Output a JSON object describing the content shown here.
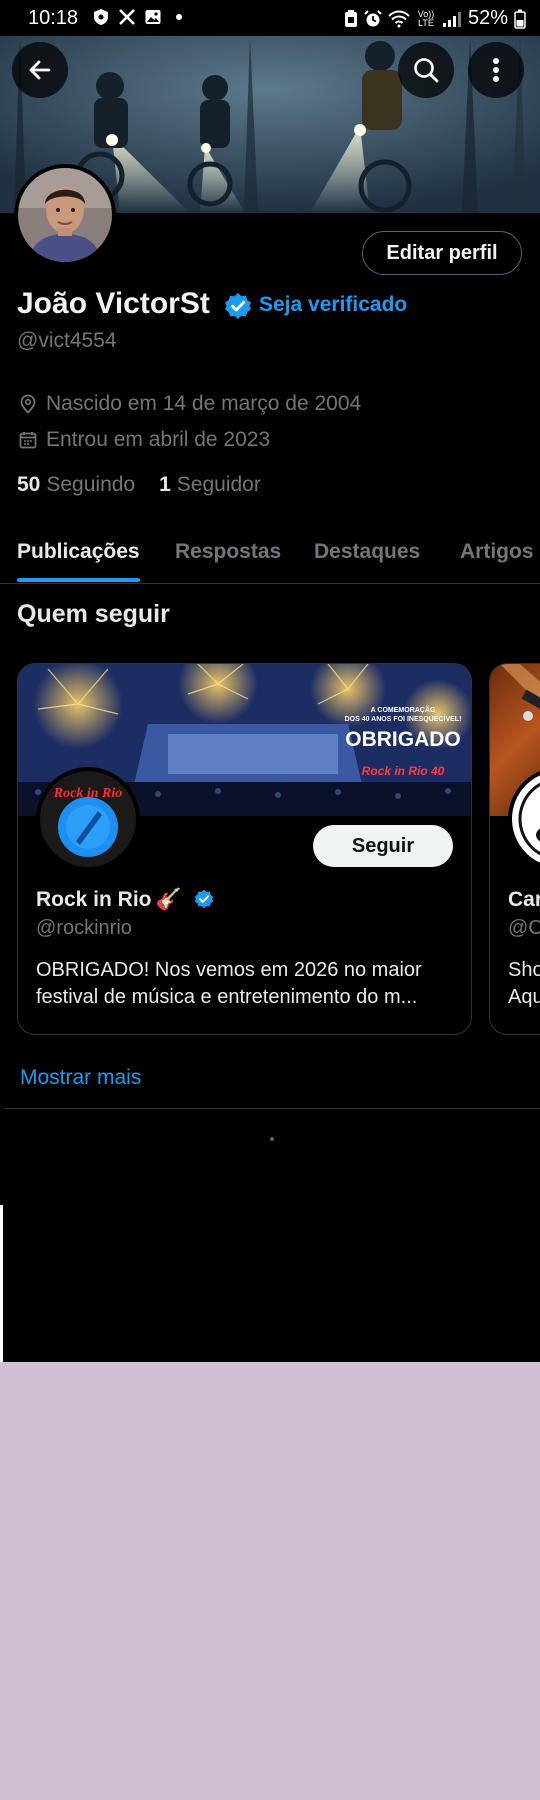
{
  "status_bar": {
    "time": "10:18",
    "battery": "52%",
    "network": "Vo)) LTE"
  },
  "profile": {
    "name": "João VictorSt",
    "verify_cta": "Seja verificado",
    "handle": "@vict4554",
    "edit_button": "Editar perfil",
    "birthday": "Nascido em 14 de março de 2004",
    "joined": "Entrou em abril de 2023",
    "following_count": "50",
    "following_label": "Seguindo",
    "followers_count": "1",
    "followers_label": "Seguidor"
  },
  "tabs": [
    "Publicações",
    "Respostas",
    "Destaques",
    "Artigos"
  ],
  "who_to_follow": {
    "title": "Quem seguir",
    "cards": [
      {
        "name": "Rock in Rio",
        "emoji": "🎸",
        "handle": "@rockinrio",
        "bio_line1": "OBRIGADO! Nos vemos em 2026 no maior",
        "bio_line2": "festival de música e entretenimento do m...",
        "follow_label": "Seguir",
        "banner_text": {
          "small_line1": "A COMEMORAÇÃO",
          "small_line2": "DOS 40 ANOS FOI INESQUECÍVEL!",
          "headline": "OBRIGADO",
          "logo": "Rock in Rio 40"
        },
        "avatar_logo": "Rock in Rio"
      },
      {
        "name": "Car",
        "handle": "@C",
        "bio_line1": "Sho",
        "bio_line2": "Aqu"
      }
    ],
    "show_more": "Mostrar mais"
  },
  "colors": {
    "accent": "#1d9bf0",
    "background": "#000000",
    "secondary_text": "#71767b",
    "outside_background": "#cfbfd4"
  }
}
